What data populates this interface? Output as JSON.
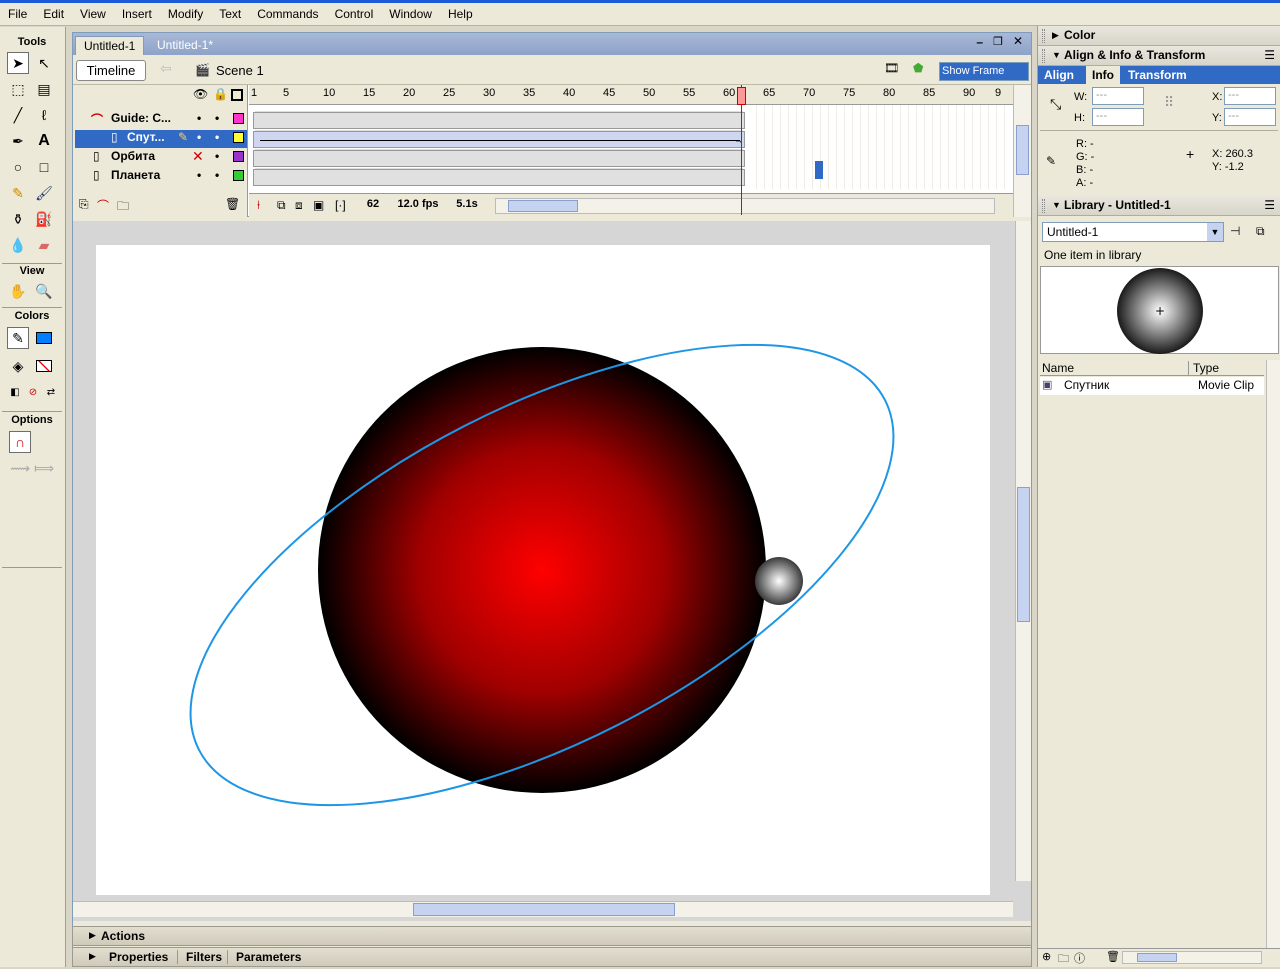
{
  "menu": [
    "File",
    "Edit",
    "View",
    "Insert",
    "Modify",
    "Text",
    "Commands",
    "Control",
    "Window",
    "Help"
  ],
  "toolbox": {
    "tools_label": "Tools",
    "view_label": "View",
    "colors_label": "Colors",
    "options_label": "Options"
  },
  "document": {
    "tabs": [
      "Untitled-1",
      "Untitled-1*"
    ],
    "timeline_button": "Timeline",
    "scene": "Scene 1",
    "show_frame": "Show Frame"
  },
  "timeline": {
    "layers": [
      {
        "name": "Guide: C...",
        "color": "#ff33cc"
      },
      {
        "name": "Спут...",
        "color": "#ffff33"
      },
      {
        "name": "Орбита",
        "color": "#9933cc"
      },
      {
        "name": "Планета",
        "color": "#33cc33"
      }
    ],
    "frame_numbers": [
      "1",
      "5",
      "10",
      "15",
      "20",
      "25",
      "30",
      "35",
      "40",
      "45",
      "50",
      "55",
      "60",
      "65",
      "70",
      "75",
      "80",
      "85",
      "90",
      "9"
    ],
    "current_frame": "62",
    "fps": "12.0 fps",
    "elapsed": "5.1s",
    "playhead_frame": 62
  },
  "panels": {
    "color": "Color",
    "align_info": "Align & Info & Transform",
    "tabs": [
      "Align",
      "Info",
      "Transform"
    ],
    "info": {
      "w": "W:",
      "h": "H:",
      "x": "X:",
      "y": "Y:",
      "w_val": "---",
      "h_val": "---",
      "x_val": "---",
      "y_val": "---",
      "r": "R: -",
      "g": "G: -",
      "b": "B: -",
      "a": "A: -",
      "cx": "X:  260.3",
      "cy": "Y:  -1.2"
    },
    "library_title": "Library - Untitled-1",
    "library_select": "Untitled-1",
    "library_count": "One item in library",
    "col_name": "Name",
    "col_type": "Type",
    "item_name": "Спутник",
    "item_type": "Movie Clip"
  },
  "bottom": {
    "actions": "Actions",
    "properties": "Properties",
    "filters": "Filters",
    "parameters": "Parameters"
  },
  "colors": {
    "accent": "#316ac5",
    "orbit": "#1e96e6",
    "planet": "#ff0000",
    "stroke_swatch": "#0080ff"
  }
}
